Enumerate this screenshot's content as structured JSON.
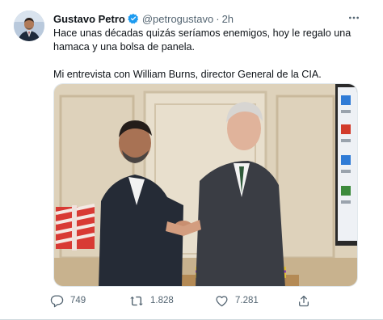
{
  "author": {
    "display_name": "Gustavo Petro",
    "handle": "@petrogustavo",
    "separator": "·",
    "time": "2h"
  },
  "tweet": {
    "line1": "Hace unas décadas quizás seríamos enemigos, hoy le regalo una hamaca y una bolsa de panela.",
    "line2": "Mi entrevista con William Burns, director General de la CIA."
  },
  "stats": {
    "replies": "749",
    "retweets": "1.828",
    "likes": "7.281"
  },
  "icons": {
    "verified": "verified-badge-icon",
    "more": "more-options-icon",
    "reply": "reply-icon",
    "retweet": "retweet-icon",
    "like": "heart-icon",
    "share": "share-icon"
  },
  "colors": {
    "verified": "#1d9bf0",
    "text": "#0f1419",
    "secondary": "#536471"
  }
}
